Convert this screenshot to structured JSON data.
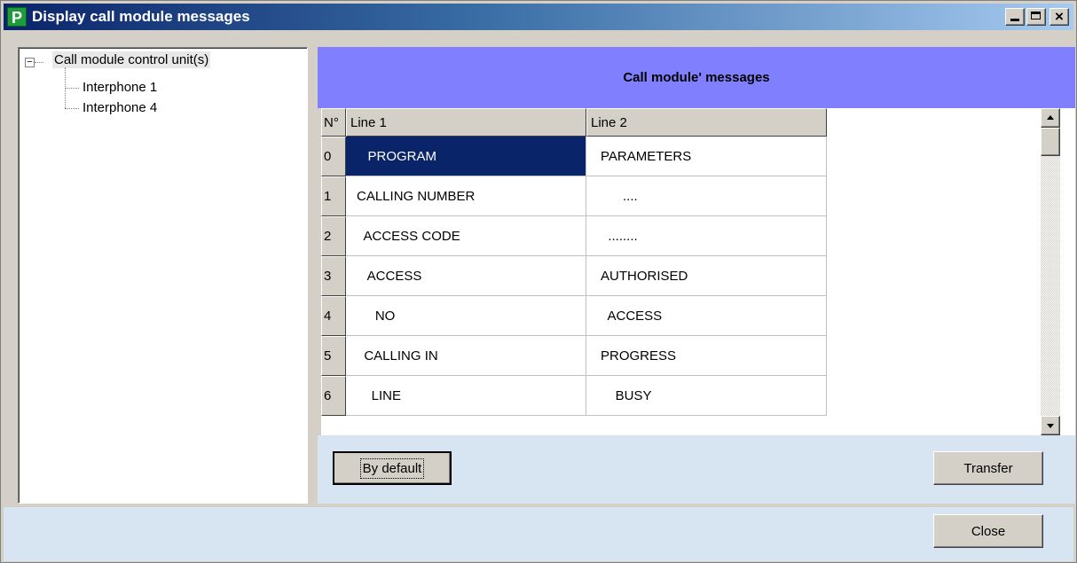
{
  "window": {
    "title": "Display call module messages",
    "icon_letter": "P",
    "controls": {
      "minimize": "minimize",
      "maximize": "maximize",
      "close": "×"
    }
  },
  "tree": {
    "root": "Call module control unit(s)",
    "expander": "−",
    "children": [
      "Interphone 1",
      "Interphone 4"
    ]
  },
  "panel": {
    "title": "Call module' messages",
    "columns": [
      "N°",
      "Line 1",
      "Line 2"
    ],
    "rows": [
      {
        "n": "0",
        "line1": "   PROGRAM",
        "line2": "PARAMETERS"
      },
      {
        "n": "1",
        "line1": "CALLING NUMBER",
        "line2": "      ...."
      },
      {
        "n": "2",
        "line1": "  ACCESS CODE",
        "line2": "  ........"
      },
      {
        "n": "3",
        "line1": "   ACCESS",
        "line2": "AUTHORISED"
      },
      {
        "n": "4",
        "line1": "     NO",
        "line2": "  ACCESS"
      },
      {
        "n": "5",
        "line1": "  CALLING IN",
        "line2": "PROGRESS"
      },
      {
        "n": "6",
        "line1": "    LINE",
        "line2": "    BUSY"
      }
    ],
    "selected_row": 0,
    "by_default_label": "By default",
    "transfer_label": "Transfer"
  },
  "footer": {
    "close_label": "Close"
  },
  "colors": {
    "banner": "#8080ff",
    "selection": "#0a246a",
    "panel_bg": "#d7e4f2"
  }
}
